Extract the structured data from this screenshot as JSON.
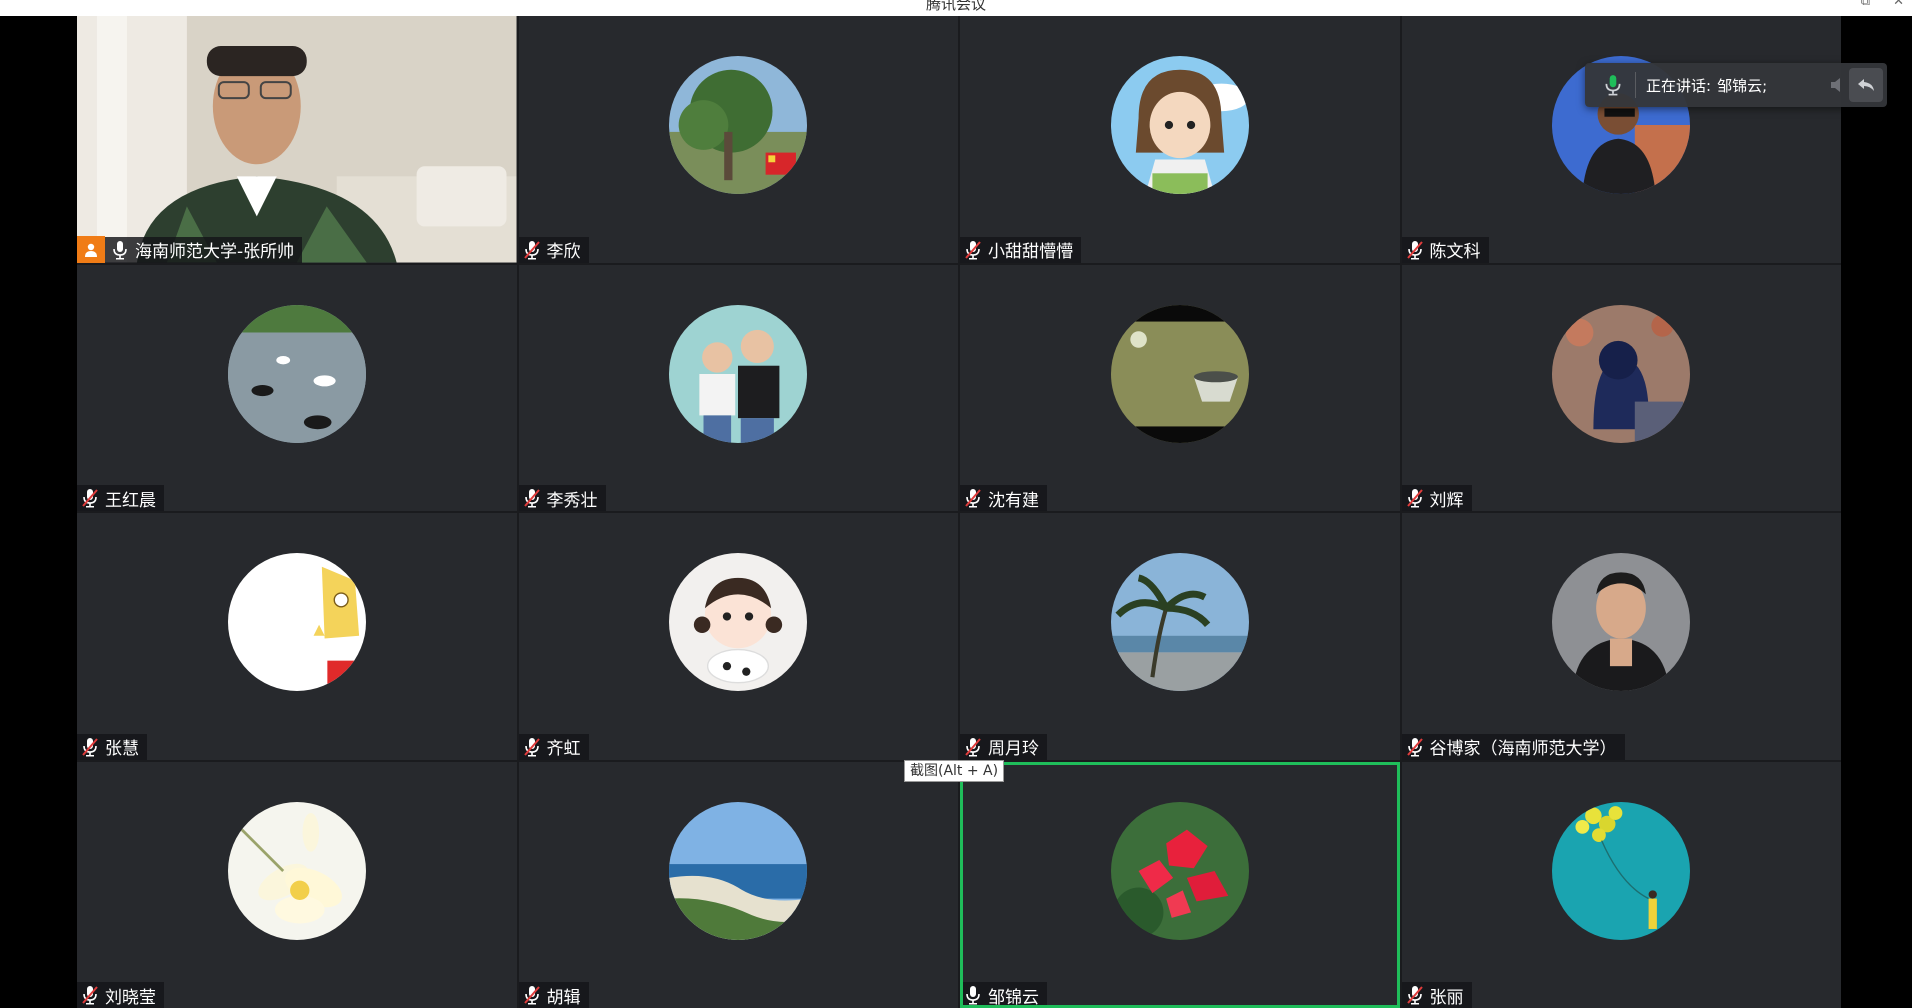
{
  "window": {
    "title": "腾讯会议"
  },
  "speaking_panel": {
    "label": "正在讲话:",
    "speaker": "邹锦云;"
  },
  "tooltip": {
    "text": "截图(Alt + A)"
  },
  "colors": {
    "tile_bg": "#27292d",
    "speaking_border": "#1fbd5a",
    "host_badge": "#f07c16",
    "muted_mic": "#e03c3c"
  },
  "participants": [
    {
      "name": "海南师范大学-张所帅",
      "mic": "on",
      "host": true,
      "video": true
    },
    {
      "name": "李欣",
      "mic": "muted"
    },
    {
      "name": "小甜甜懵懵",
      "mic": "muted"
    },
    {
      "name": "陈文科",
      "mic": "muted"
    },
    {
      "name": "王红晨",
      "mic": "muted"
    },
    {
      "name": "李秀壮",
      "mic": "muted"
    },
    {
      "name": "沈有建",
      "mic": "muted"
    },
    {
      "name": "刘辉",
      "mic": "muted"
    },
    {
      "name": "张慧",
      "mic": "muted"
    },
    {
      "name": "齐虹",
      "mic": "muted"
    },
    {
      "name": "周月玲",
      "mic": "muted"
    },
    {
      "name": "谷博家（海南师范大学）",
      "mic": "muted"
    },
    {
      "name": "刘晓莹",
      "mic": "muted"
    },
    {
      "name": "胡辑",
      "mic": "muted"
    },
    {
      "name": "邹锦云",
      "mic": "on",
      "speaking": true
    },
    {
      "name": "张丽",
      "mic": "muted"
    }
  ]
}
